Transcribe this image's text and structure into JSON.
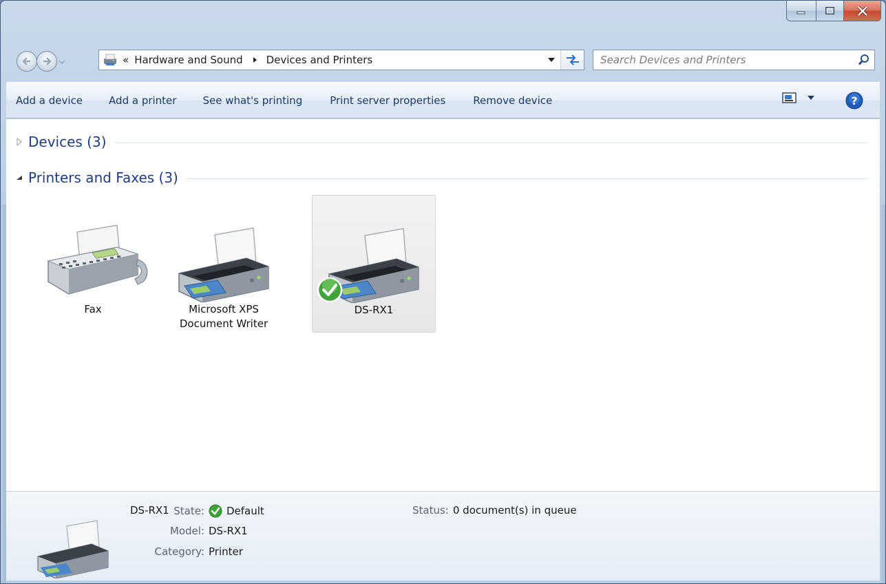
{
  "window": {
    "caption_buttons": [
      "minimize",
      "maximize",
      "close"
    ]
  },
  "nav": {
    "address_overflow": "«",
    "breadcrumbs": [
      "Hardware and Sound",
      "Devices and Printers"
    ],
    "search_placeholder": "Search Devices and Printers"
  },
  "toolbar": {
    "commands": [
      "Add a device",
      "Add a printer",
      "See what's printing",
      "Print server properties",
      "Remove device"
    ]
  },
  "groups": {
    "devices": {
      "title": "Devices (3)",
      "expanded": false
    },
    "printers": {
      "title": "Printers and Faxes (3)",
      "expanded": true
    }
  },
  "items": [
    {
      "label": "Fax",
      "icon": "fax-icon",
      "selected": false
    },
    {
      "label": "Microsoft XPS Document Writer",
      "icon": "printer-icon",
      "selected": false
    },
    {
      "label": "DS-RX1",
      "icon": "printer-icon",
      "selected": true,
      "default": true
    }
  ],
  "details": {
    "name": "DS-RX1",
    "state_label": "State:",
    "state_value": "Default",
    "model_label": "Model:",
    "model_value": "DS-RX1",
    "category_label": "Category:",
    "category_value": "Printer",
    "status_label": "Status:",
    "status_value": "0 document(s) in queue"
  },
  "colors": {
    "link_blue": "#1f3d82",
    "command_text": "#1e3965",
    "frame_blue": "#bdd0e5",
    "check_green": "#3fa33a"
  }
}
